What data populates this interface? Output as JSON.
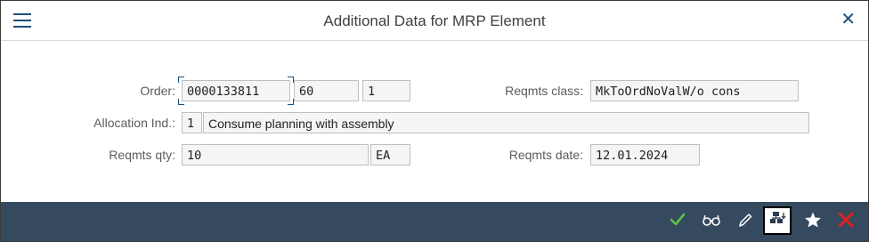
{
  "dialog": {
    "title": "Additional Data for MRP Element"
  },
  "form": {
    "order": {
      "label": "Order:",
      "number": "0000133811",
      "item": "60",
      "schedule": "1"
    },
    "reqmts_class": {
      "label": "Reqmts class:",
      "value": "MkToOrdNoValW/o cons"
    },
    "allocation": {
      "label": "Allocation Ind.:",
      "code": "1",
      "text": "Consume planning with assembly"
    },
    "reqmts_qty": {
      "label": "Reqmts qty:",
      "value": "10",
      "unit": "EA"
    },
    "reqmts_date": {
      "label": "Reqmts date:",
      "value": "12.01.2024"
    }
  },
  "footer": {
    "icons": [
      "checkmark-icon",
      "glasses-icon",
      "pencil-icon",
      "hierarchy-icon",
      "star-icon",
      "cancel-icon"
    ],
    "colors": {
      "bar": "#354a5f",
      "confirm": "#5fbf4a",
      "cancel": "#e02020"
    }
  }
}
